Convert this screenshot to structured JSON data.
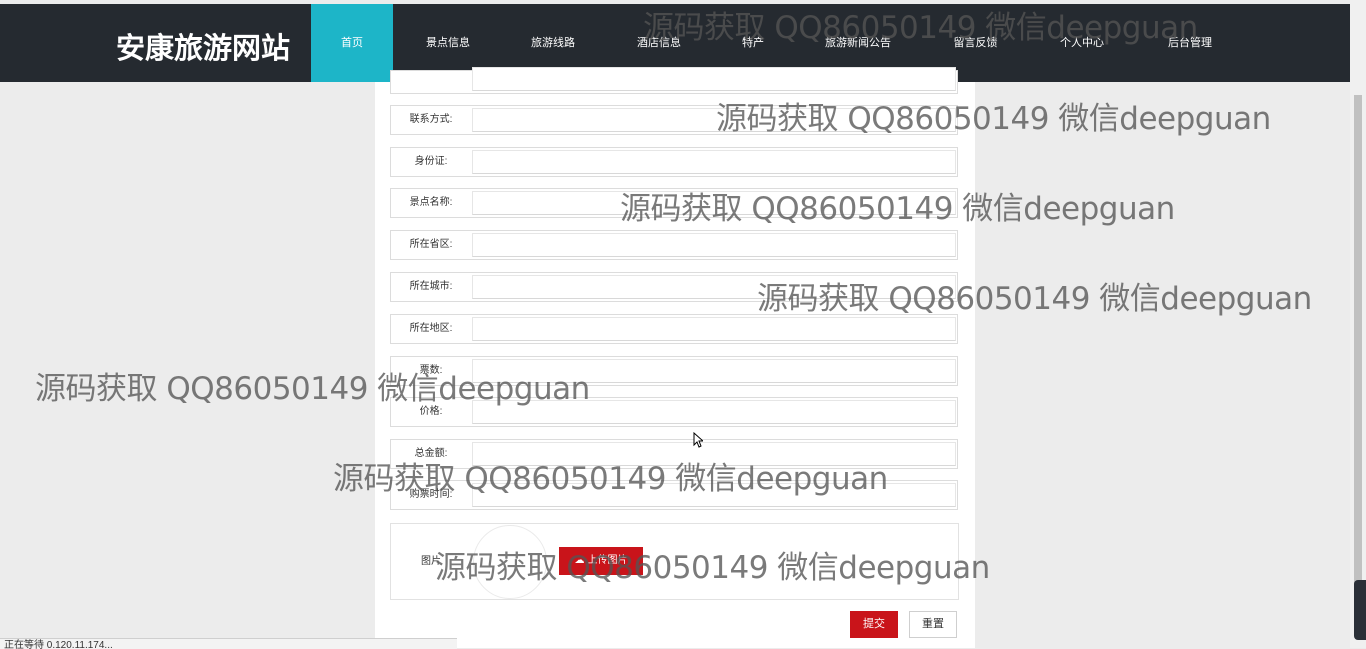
{
  "site": {
    "title": "安康旅游网站"
  },
  "nav": [
    {
      "label": "首页",
      "active": true
    },
    {
      "label": "景点信息"
    },
    {
      "label": "旅游线路"
    },
    {
      "label": "酒店信息"
    },
    {
      "label": "特产"
    },
    {
      "label": "旅游新闻公告"
    },
    {
      "label": "留言反馈"
    },
    {
      "label": "个人中心"
    },
    {
      "label": "后台管理"
    }
  ],
  "form": {
    "fields": [
      {
        "label": "联系方式:",
        "value": ""
      },
      {
        "label": "身份证:",
        "value": ""
      },
      {
        "label": "景点名称:",
        "value": ""
      },
      {
        "label": "所在省区:",
        "value": ""
      },
      {
        "label": "所在城市:",
        "value": ""
      },
      {
        "label": "所在地区:",
        "value": ""
      },
      {
        "label": "票数:",
        "value": ""
      },
      {
        "label": "价格:",
        "value": ""
      },
      {
        "label": "总金额:",
        "value": ""
      },
      {
        "label": "购票时间:",
        "value": ""
      }
    ],
    "image_label": "图片",
    "upload_label": "上传图片",
    "submit_label": "提交",
    "reset_label": "重置"
  },
  "watermark": "源码获取 QQ86050149 微信deepguan",
  "status_bar": {
    "text": "正在等待 0.120.11.174..."
  },
  "icons": {
    "upload": "cloud-upload-icon",
    "cursor": "mouse-cursor-icon"
  },
  "colors": {
    "nav_bg": "#252a30",
    "nav_active": "#1db5c8",
    "primary": "#c9141a"
  }
}
